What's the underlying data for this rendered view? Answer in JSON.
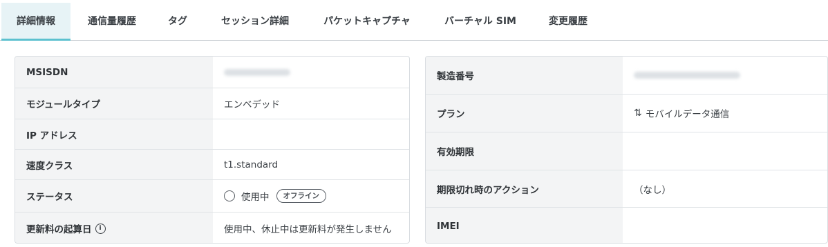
{
  "tabs": [
    {
      "label": "詳細情報",
      "active": true
    },
    {
      "label": "通信量履歴"
    },
    {
      "label": "タグ"
    },
    {
      "label": "セッション詳細"
    },
    {
      "label": "パケットキャプチャ"
    },
    {
      "label": "バーチャル SIM"
    },
    {
      "label": "変更履歴"
    }
  ],
  "left": {
    "msisdn_label": "MSISDN",
    "module_label": "モジュールタイプ",
    "module_value": "エンベデッド",
    "ip_label": "IP アドレス",
    "speed_label": "速度クラス",
    "speed_value": "t1.standard",
    "status_label": "ステータス",
    "status_value": "使用中",
    "status_badge": "オフライン",
    "renewal_label": "更新料の起算日",
    "renewal_info_icon": "i",
    "renewal_value": "使用中、休止中は更新料が発生しません"
  },
  "right": {
    "serial_label": "製造番号",
    "plan_label": "プラン",
    "plan_icon": "⇅",
    "plan_value": "モバイルデータ通信",
    "expiry_label": "有効期限",
    "expiry_action_label": "期限切れ時のアクション",
    "expiry_action_value": "（なし）",
    "imei_label": "IMEI"
  },
  "colors": {
    "accent": "#5cc1cf",
    "label_bg": "#f3f4f5",
    "border": "#d9dde1"
  }
}
